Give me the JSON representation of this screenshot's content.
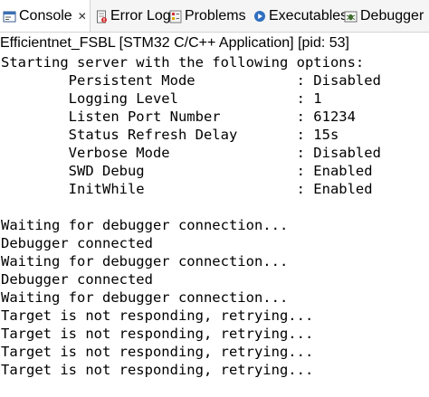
{
  "tabs": [
    {
      "label": "Console",
      "icon": "console-icon",
      "active": true,
      "close": "✕"
    },
    {
      "label": "Error Log",
      "icon": "error-log-icon"
    },
    {
      "label": "Problems",
      "icon": "problems-icon"
    },
    {
      "label": "Executables",
      "icon": "executables-icon"
    },
    {
      "label": "Debugger",
      "icon": "debugger-icon"
    }
  ],
  "process_line": "Efficientnet_FSBL [STM32 C/C++ Application]  [pid: 53]",
  "console_lines": [
    "Starting server with the following options:",
    "        Persistent Mode            : Disabled",
    "        Logging Level              : 1",
    "        Listen Port Number         : 61234",
    "        Status Refresh Delay       : 15s",
    "        Verbose Mode               : Disabled",
    "        SWD Debug                  : Enabled",
    "        InitWhile                  : Enabled",
    "",
    "Waiting for debugger connection...",
    "Debugger connected",
    "Waiting for debugger connection...",
    "Debugger connected",
    "Waiting for debugger connection...",
    "Target is not responding, retrying...",
    "Target is not responding, retrying...",
    "Target is not responding, retrying...",
    "Target is not responding, retrying..."
  ]
}
